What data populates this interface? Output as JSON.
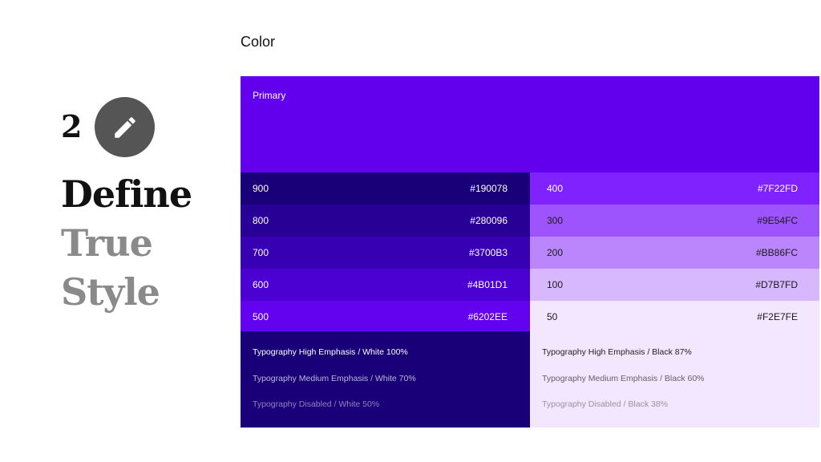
{
  "left": {
    "step_number": "2",
    "icon": "pencil-icon",
    "headline": [
      "Define",
      "True",
      "Style"
    ]
  },
  "section_title": "Color",
  "primary": {
    "label": "Primary",
    "color": "#6200EE"
  },
  "dark_shades": [
    {
      "name": "900",
      "hex": "#190078",
      "bg": "#190078",
      "fg": "#FFFFFF"
    },
    {
      "name": "800",
      "hex": "#280096",
      "bg": "#280096",
      "fg": "#FFFFFF"
    },
    {
      "name": "700",
      "hex": "#3700B3",
      "bg": "#3700B3",
      "fg": "#FFFFFF"
    },
    {
      "name": "600",
      "hex": "#4B01D1",
      "bg": "#4B01D1",
      "fg": "#FFFFFF"
    },
    {
      "name": "500",
      "hex": "#6202EE",
      "bg": "#6202EE",
      "fg": "#FFFFFF"
    }
  ],
  "light_shades": [
    {
      "name": "400",
      "hex": "#7F22FD",
      "bg": "#7F22FD",
      "fg": "#FFFFFF"
    },
    {
      "name": "300",
      "hex": "#9E54FC",
      "bg": "#9E54FC",
      "fg": "#1A1A1A"
    },
    {
      "name": "200",
      "hex": "#BB86FC",
      "bg": "#BB86FC",
      "fg": "#1A1A1A"
    },
    {
      "name": "100",
      "hex": "#D7B7FD",
      "bg": "#D7B7FD",
      "fg": "#1A1A1A"
    },
    {
      "name": "50",
      "hex": "#F2E7FE",
      "bg": "#F2E7FE",
      "fg": "#1A1A1A"
    }
  ],
  "typography_dark": [
    {
      "text": "Typography High Emphasis / White 100%",
      "color": "rgba(255,255,255,1)"
    },
    {
      "text": "Typography Medium Emphasis / White 70%",
      "color": "rgba(255,255,255,0.7)"
    },
    {
      "text": "Typography Disabled / White 50%",
      "color": "rgba(255,255,255,0.5)"
    }
  ],
  "typography_light": [
    {
      "text": "Typography High Emphasis / Black 87%",
      "color": "rgba(0,0,0,0.87)"
    },
    {
      "text": "Typography Medium Emphasis / Black 60%",
      "color": "rgba(0,0,0,0.6)"
    },
    {
      "text": "Typography Disabled / Black 38%",
      "color": "rgba(0,0,0,0.38)"
    }
  ]
}
